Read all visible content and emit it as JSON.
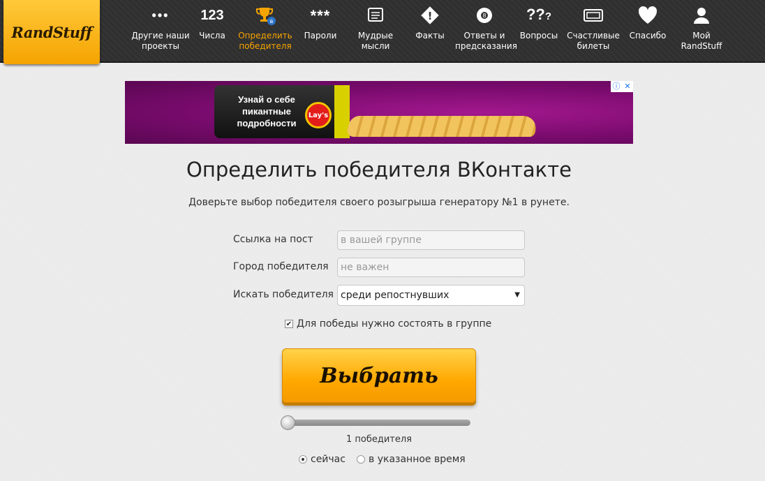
{
  "logo": "RandStuff",
  "nav": [
    {
      "icon": "more-dots-icon",
      "glyph": "•••",
      "label": "Другие наши\nпроекты"
    },
    {
      "icon": "numbers-icon",
      "glyph": "123",
      "label": "Числа"
    },
    {
      "icon": "trophy-icon",
      "glyph": "🏆",
      "badge": "в",
      "label": "Определить\nпобедителя",
      "active": true
    },
    {
      "icon": "password-icon",
      "glyph": "***",
      "label": "Пароли"
    },
    {
      "icon": "scroll-icon",
      "glyph": "📜",
      "label": "Мудрые\nмысли"
    },
    {
      "icon": "fact-icon",
      "glyph": "!",
      "label": "Факты"
    },
    {
      "icon": "eight-ball-icon",
      "glyph": "8",
      "label": "Ответы и\nпредсказания"
    },
    {
      "icon": "questions-icon",
      "glyph": "??",
      "label": "Вопросы"
    },
    {
      "icon": "ticket-icon",
      "glyph": "▭",
      "label": "Счастливые\nбилеты"
    },
    {
      "icon": "heart-icon",
      "glyph": "♥",
      "label": "Спасибо"
    },
    {
      "icon": "user-icon",
      "glyph": "👤",
      "label": "Мой\nRandStuff"
    }
  ],
  "ad": {
    "text": "Узнай о себе пикантные подробности",
    "brand": "Lay's"
  },
  "page": {
    "title": "Определить победителя ВКонтакте",
    "subtitle": "Доверьте выбор победителя своего розыгрыша генератору №1 в рунете."
  },
  "form": {
    "post_label": "Ссылка на пост",
    "post_placeholder": "в вашей группе",
    "city_label": "Город победителя",
    "city_placeholder": "не важен",
    "search_label": "Искать победителя",
    "search_value": "среди репостнувших",
    "member_check_label": "Для победы нужно состоять в группе",
    "member_checked": true,
    "submit_label": "Выбрать",
    "winners_count": 1,
    "winners_text": "1 победителя",
    "time_now_label": "сейчас",
    "time_scheduled_label": "в указанное время"
  }
}
